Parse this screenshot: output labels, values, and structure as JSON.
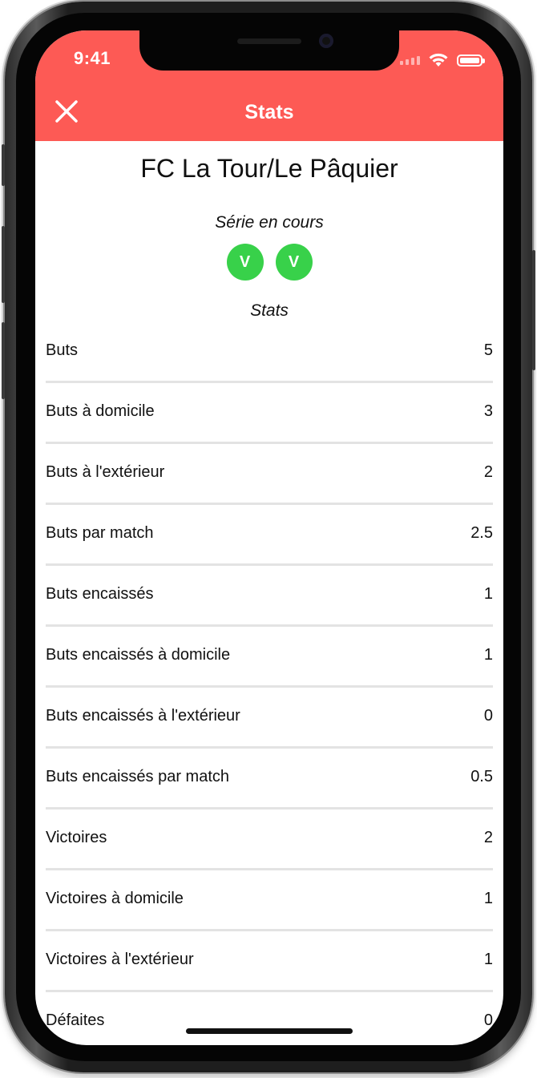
{
  "status_bar": {
    "time": "9:41"
  },
  "nav": {
    "title": "Stats",
    "close_icon": "close-icon"
  },
  "team": {
    "name": "FC La Tour/Le Pâquier"
  },
  "serie": {
    "label": "Série en cours",
    "results": [
      "V",
      "V"
    ],
    "result_color": "#38d14a"
  },
  "stats": {
    "label": "Stats",
    "rows": [
      {
        "label": "Buts",
        "value": "5"
      },
      {
        "label": "Buts à domicile",
        "value": "3"
      },
      {
        "label": "Buts à l'extérieur",
        "value": "2"
      },
      {
        "label": "Buts par match",
        "value": "2.5"
      },
      {
        "label": "Buts encaissés",
        "value": "1"
      },
      {
        "label": "Buts encaissés à domicile",
        "value": "1"
      },
      {
        "label": "Buts encaissés à l'extérieur",
        "value": "0"
      },
      {
        "label": "Buts encaissés par match",
        "value": "0.5"
      },
      {
        "label": "Victoires",
        "value": "2"
      },
      {
        "label": "Victoires à domicile",
        "value": "1"
      },
      {
        "label": "Victoires à l'extérieur",
        "value": "1"
      },
      {
        "label": "Défaites",
        "value": "0"
      }
    ]
  },
  "colors": {
    "header": "#fd5a55",
    "accent_green": "#38d14a"
  }
}
